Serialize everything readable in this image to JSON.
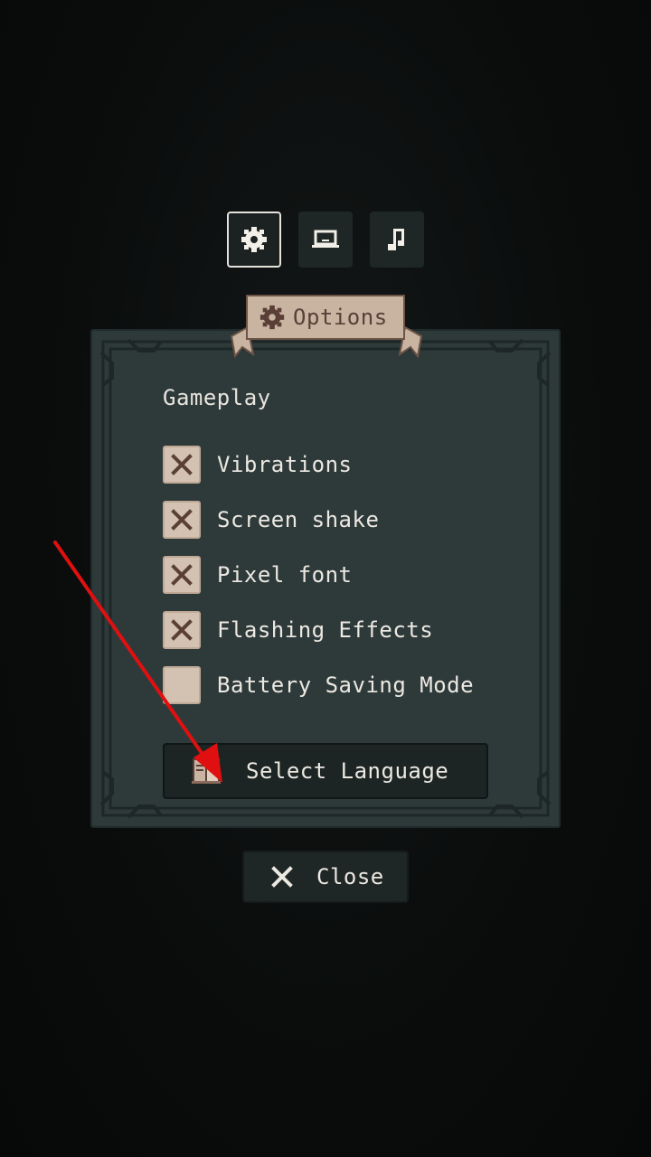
{
  "tabs": [
    {
      "name": "gameplay",
      "icon": "gear-icon",
      "active": true
    },
    {
      "name": "display",
      "icon": "laptop-icon",
      "active": false
    },
    {
      "name": "audio",
      "icon": "music-note-icon",
      "active": false
    }
  ],
  "banner": {
    "title": "Options",
    "icon": "gear-icon"
  },
  "section": {
    "title": "Gameplay"
  },
  "options": [
    {
      "label": "Vibrations",
      "checked": true
    },
    {
      "label": "Screen shake",
      "checked": true
    },
    {
      "label": "Pixel font",
      "checked": true
    },
    {
      "label": "Flashing Effects",
      "checked": true
    },
    {
      "label": "Battery Saving Mode",
      "checked": false
    }
  ],
  "language_button": {
    "label": "Select Language",
    "icon": "book-icon"
  },
  "close_button": {
    "label": "Close",
    "icon": "close-icon"
  },
  "colors": {
    "panel": "#2e3a3a",
    "checkbox": "#d3c1b1",
    "check_mark": "#5a3f36",
    "text": "#ece8e2",
    "annotation": "#e01010"
  }
}
